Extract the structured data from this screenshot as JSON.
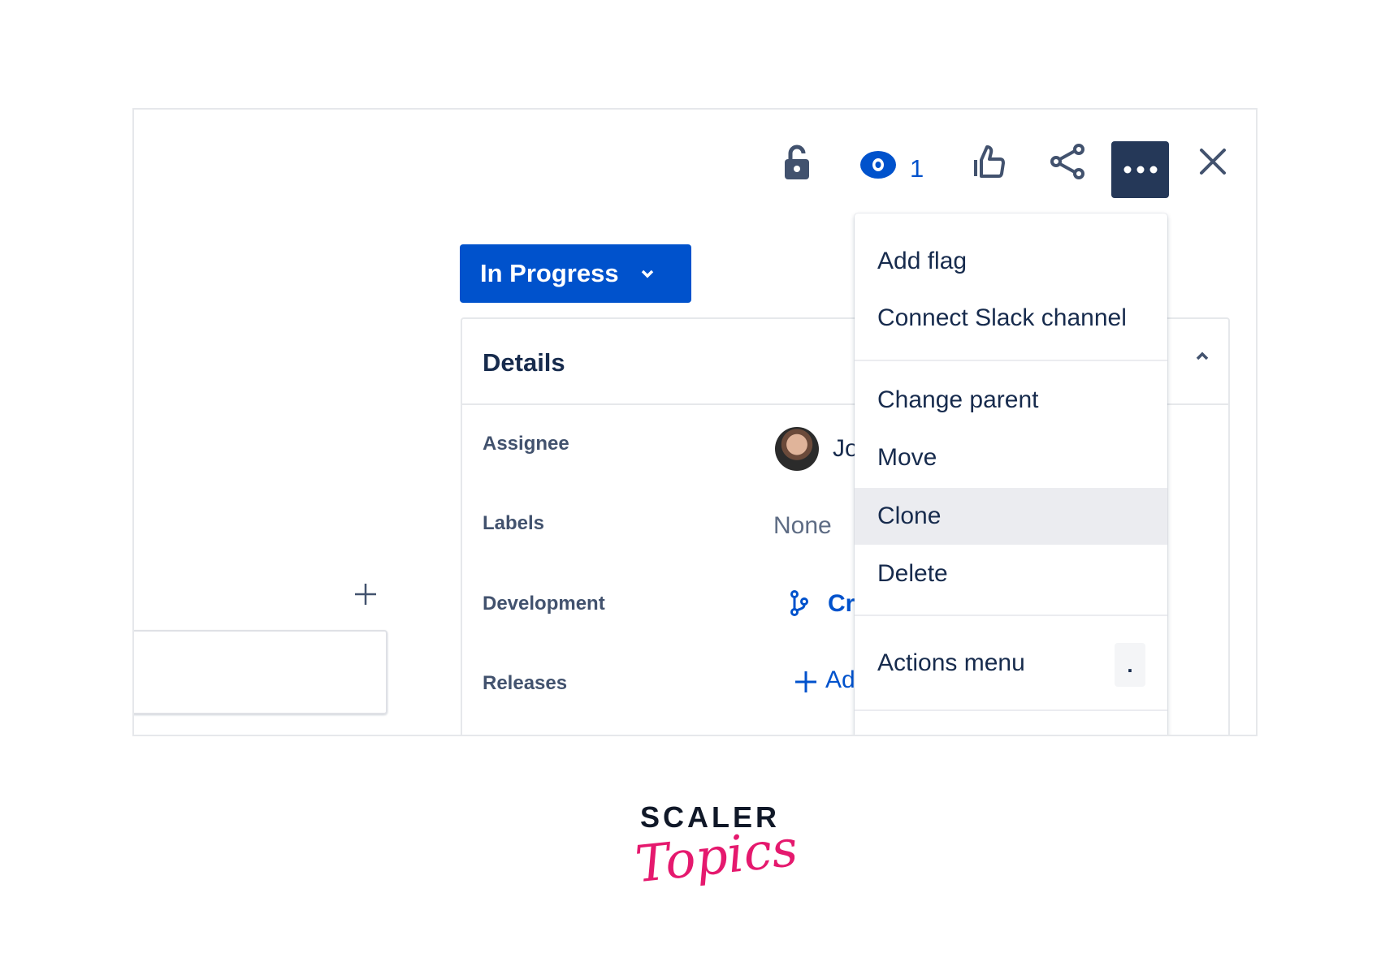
{
  "toolbar": {
    "watch_count": "1",
    "icons": [
      "unlock-icon",
      "eye-icon",
      "thumbs-up-icon",
      "share-icon",
      "more-icon",
      "close-icon"
    ]
  },
  "status": {
    "label": "In Progress",
    "color": "#0052cc"
  },
  "details": {
    "title": "Details",
    "rows": [
      {
        "label": "Assignee",
        "value": "Jo"
      },
      {
        "label": "Labels",
        "value": "None"
      },
      {
        "label": "Development",
        "value": "Cr"
      },
      {
        "label": "Releases",
        "value": "Ad"
      }
    ]
  },
  "menu": {
    "items": [
      "Add flag",
      "Connect Slack channel",
      "Change parent",
      "Move",
      "Clone",
      "Delete",
      "Actions menu"
    ],
    "shortcut": ".",
    "highlighted": "Clone"
  },
  "logo": {
    "line1": "SCALER",
    "line2": "Topics"
  }
}
